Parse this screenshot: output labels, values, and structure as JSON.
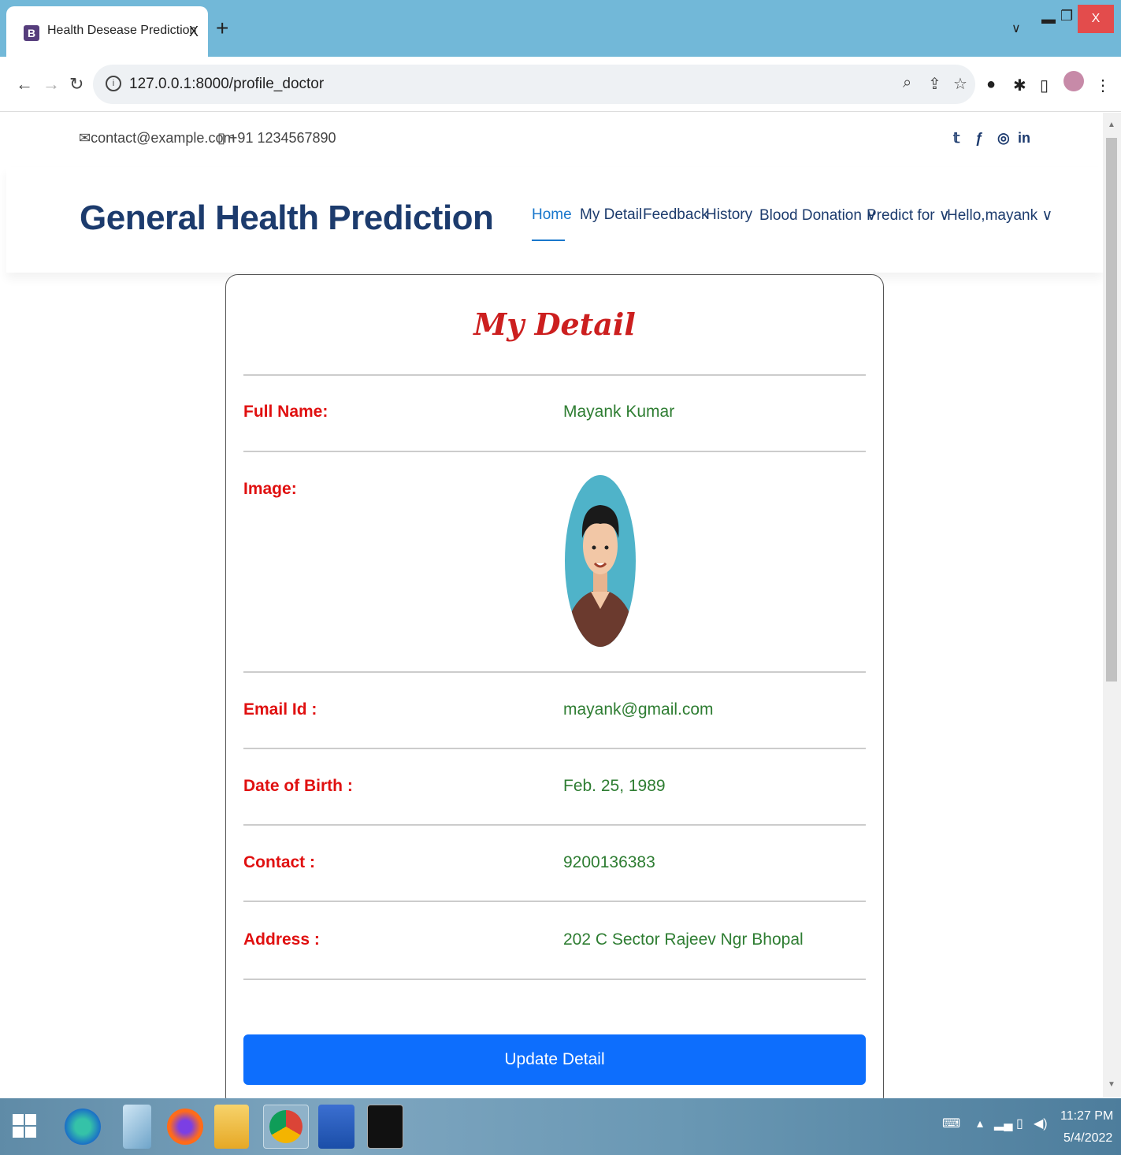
{
  "browser": {
    "tab_title": "Health Desease Prediction",
    "tab_favicon": "B",
    "tab_close": "X",
    "new_tab": "+",
    "url": "127.0.0.1:8000/profile_doctor",
    "window_close": "X"
  },
  "topbar": {
    "email": "contact@example.com",
    "phone": "+91 1234567890",
    "social_icons": [
      "twitter-icon",
      "facebook-icon",
      "instagram-icon",
      "linkedin-icon"
    ]
  },
  "header": {
    "brand": "General Health Prediction",
    "menu": [
      {
        "label": "Home",
        "active": true
      },
      {
        "label": "My Detail"
      },
      {
        "label": "Feedback"
      },
      {
        "label": "History"
      },
      {
        "label": "Blood Donation ∨"
      },
      {
        "label": "Predict for ∨"
      },
      {
        "label": "Hello,mayank ∨"
      }
    ]
  },
  "profile": {
    "title": "My Detail",
    "fields": {
      "full_name_label": "Full Name:",
      "full_name": "Mayank Kumar",
      "image_label": "Image:",
      "email_label": "Email Id :",
      "email": "mayank@gmail.com",
      "dob_label": "Date of Birth :",
      "dob": "Feb. 25, 1989",
      "contact_label": "Contact :",
      "contact": "9200136383",
      "address_label": "Address :",
      "address": "202 C Sector Rajeev Ngr Bhopal"
    },
    "update_button": "Update Detail"
  },
  "taskbar": {
    "time": "11:27 PM",
    "date": "5/4/2022"
  },
  "colors": {
    "label_red": "#e01010",
    "value_green": "#2e7d32",
    "brand_navy": "#1c3b6d",
    "button_blue": "#0d6efd"
  }
}
